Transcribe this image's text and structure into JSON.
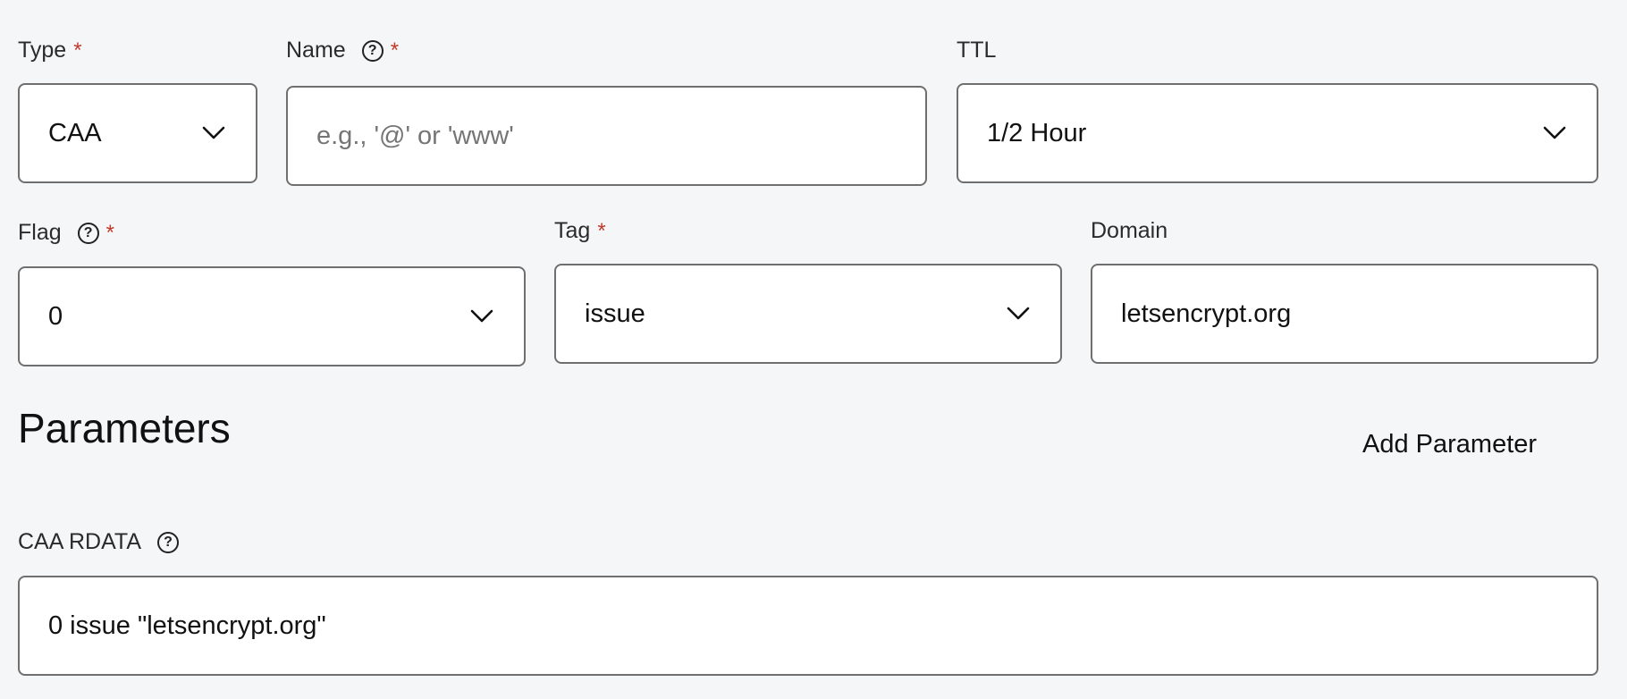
{
  "row1": {
    "type": {
      "label": "Type",
      "value": "CAA"
    },
    "name": {
      "label": "Name",
      "placeholder": "e.g., '@' or 'www'"
    },
    "ttl": {
      "label": "TTL",
      "value": "1/2 Hour"
    }
  },
  "row2": {
    "flag": {
      "label": "Flag",
      "value": "0"
    },
    "tag": {
      "label": "Tag",
      "value": "issue"
    },
    "domain": {
      "label": "Domain",
      "value": "letsencrypt.org"
    }
  },
  "parameters": {
    "heading": "Parameters",
    "add_label": "Add Parameter"
  },
  "rdata": {
    "label": "CAA RDATA",
    "value": "0 issue \"letsencrypt.org\""
  },
  "common": {
    "required_marker": "*",
    "help_glyph": "?"
  },
  "icons": {
    "help": "help-circle-icon",
    "dropdown": "chevron-down-icon"
  },
  "colors": {
    "background": "#f5f6f8",
    "required": "#c0392b",
    "border": "#6f6f6f"
  }
}
